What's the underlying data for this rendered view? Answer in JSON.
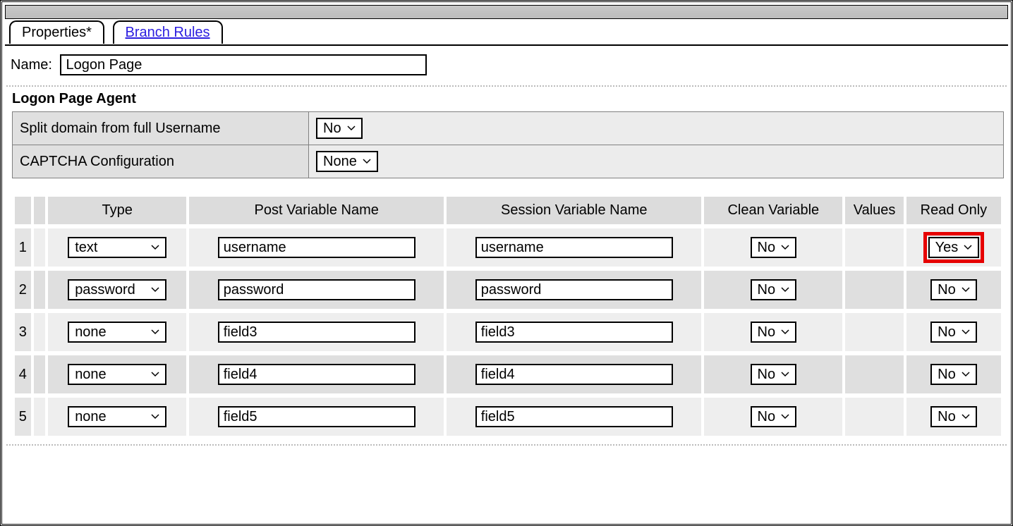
{
  "tabs": {
    "properties": "Properties*",
    "branch_rules": "Branch Rules"
  },
  "name_label": "Name:",
  "name_value": "Logon Page",
  "section_title": "Logon Page Agent",
  "settings": {
    "split_domain_label": "Split domain from full Username",
    "split_domain_value": "No",
    "captcha_label": "CAPTCHA Configuration",
    "captcha_value": "None"
  },
  "columns": {
    "type": "Type",
    "post": "Post Variable Name",
    "session": "Session Variable Name",
    "clean": "Clean Variable",
    "values": "Values",
    "readonly": "Read Only"
  },
  "rows": [
    {
      "n": "1",
      "type": "text",
      "post": "username",
      "session": "username",
      "clean": "No",
      "readonly": "Yes",
      "highlight_readonly": true
    },
    {
      "n": "2",
      "type": "password",
      "post": "password",
      "session": "password",
      "clean": "No",
      "readonly": "No",
      "highlight_readonly": false
    },
    {
      "n": "3",
      "type": "none",
      "post": "field3",
      "session": "field3",
      "clean": "No",
      "readonly": "No",
      "highlight_readonly": false
    },
    {
      "n": "4",
      "type": "none",
      "post": "field4",
      "session": "field4",
      "clean": "No",
      "readonly": "No",
      "highlight_readonly": false
    },
    {
      "n": "5",
      "type": "none",
      "post": "field5",
      "session": "field5",
      "clean": "No",
      "readonly": "No",
      "highlight_readonly": false
    }
  ]
}
